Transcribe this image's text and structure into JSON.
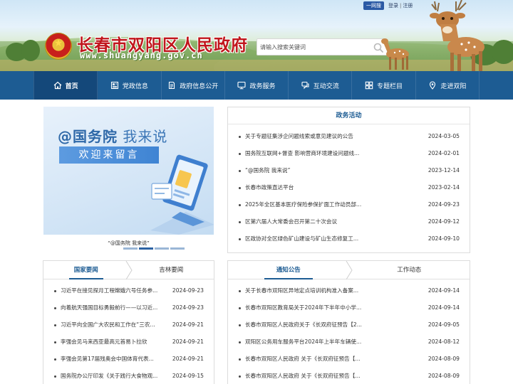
{
  "header": {
    "site_title": "长春市双阳区人民政府",
    "site_domain": "www.shuangyang.gov.cn",
    "top_links": {
      "yiwang": "一网搜",
      "login": "登录",
      "separator": "|",
      "register": "注册"
    },
    "search": {
      "placeholder": "请输入搜索关键词"
    }
  },
  "nav": {
    "items": [
      {
        "label": "首页",
        "icon": "home-icon"
      },
      {
        "label": "党政信息",
        "icon": "news-icon"
      },
      {
        "label": "政府信息公开",
        "icon": "document-icon"
      },
      {
        "label": "政务服务",
        "icon": "monitor-icon"
      },
      {
        "label": "互动交流",
        "icon": "chat-icon"
      },
      {
        "label": "专题栏目",
        "icon": "grid-icon"
      },
      {
        "label": "走进双阳",
        "icon": "location-icon"
      }
    ],
    "active_index": 0
  },
  "slider": {
    "headline_prefix": "@国务院",
    "headline_suffix": "我来说",
    "banner": "欢迎来留言",
    "caption": "“@国务院 我来说”",
    "slide_count": 4,
    "active_slide": 1
  },
  "zhengwu": {
    "title": "政务活动",
    "items": [
      {
        "text": "关于专题征集涉企问题线索或意见建议的公告",
        "date": "2024-03-05"
      },
      {
        "text": "国务院互联网+督查 影响营商环境建设问题线...",
        "date": "2024-02-01"
      },
      {
        "text": "“@国务院 我来说”",
        "date": "2023-12-14"
      },
      {
        "text": "长春市政策直达平台",
        "date": "2023-02-14"
      },
      {
        "text": "2025年全区基本医疗保险参保扩面工作动员部...",
        "date": "2024-09-23"
      },
      {
        "text": "区第六届人大常委会召开第二十次会议",
        "date": "2024-09-12"
      },
      {
        "text": "区政协对全区绿色矿山建设与矿山生态修复工...",
        "date": "2024-09-10"
      }
    ]
  },
  "news": {
    "tabs": [
      "国家要闻",
      "吉林要闻"
    ],
    "active_tab": 0,
    "items": [
      {
        "text": "习近平在接见探月工程嫦娥六号任务参...",
        "date": "2024-09-23"
      },
      {
        "text": "向着航天强国目标勇毅前行——以习近...",
        "date": "2024-09-23"
      },
      {
        "text": "习近平向全国广大农民和工作在“三农...",
        "date": "2024-09-21"
      },
      {
        "text": "李强会见马来西亚最高元首易卜拉欣",
        "date": "2024-09-21"
      },
      {
        "text": "李强会见第17届残奥会中国体育代表...",
        "date": "2024-09-21"
      },
      {
        "text": "国务院办公厅印发《关于践行大食物观...",
        "date": "2024-09-15"
      }
    ]
  },
  "notices": {
    "tabs": [
      "通知公告",
      "工作动态"
    ],
    "active_tab": 0,
    "items": [
      {
        "text": "关于长春市双阳区异地定点培训机构准入备案...",
        "date": "2024-09-14"
      },
      {
        "text": "长春市双阳区教育局关于2024年下半年中小学...",
        "date": "2024-09-14"
      },
      {
        "text": "长春市双阳区人民政府关于《长双府征预告【2...",
        "date": "2024-09-05"
      },
      {
        "text": "双阳区公务用车服务平台2024年上半年车辆使...",
        "date": "2024-08-12"
      },
      {
        "text": "长春市双阳区人民政府 关于《长双府征预告【...",
        "date": "2024-08-09"
      },
      {
        "text": "长春市双阳区人民政府 关于《长双府征预告【...",
        "date": "2024-08-09"
      }
    ]
  },
  "colors": {
    "nav_bg": "#1d5c93",
    "nav_active": "#14487a",
    "title_red": "#c0161c",
    "accent_blue": "#1d5c93"
  }
}
